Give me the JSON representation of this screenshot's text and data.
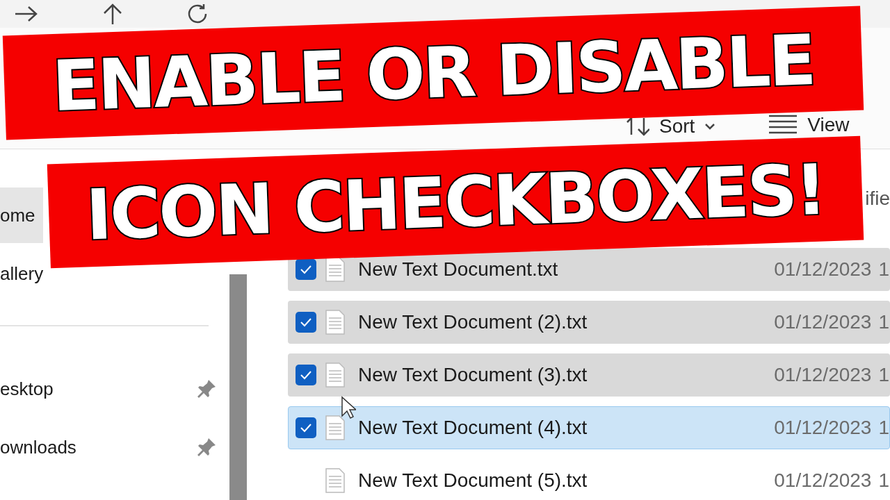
{
  "banner": {
    "lines": [
      "ENABLE OR DISABLE",
      "ICON CHECKBOXES!"
    ]
  },
  "toolbar": {
    "sort": {
      "label": "Sort"
    },
    "view": {
      "label": "View"
    }
  },
  "sidebar": {
    "items": [
      {
        "label": "ome",
        "selected": true,
        "pinned": false,
        "separator_before": false
      },
      {
        "label": "allery",
        "selected": false,
        "pinned": false,
        "separator_before": false
      },
      {
        "label": "esktop",
        "selected": false,
        "pinned": true,
        "separator_before": true
      },
      {
        "label": "ownloads",
        "selected": false,
        "pinned": true,
        "separator_before": false
      }
    ]
  },
  "file_list": {
    "columns": [
      {
        "label": "ifie"
      }
    ],
    "rows": [
      {
        "name": "New Text Document.txt",
        "date": "01/12/2023",
        "column_4": "1",
        "checked": true,
        "selected": true,
        "hovered": false
      },
      {
        "name": "New Text Document (2).txt",
        "date": "01/12/2023",
        "column_4": "1",
        "checked": true,
        "selected": true,
        "hovered": false
      },
      {
        "name": "New Text Document (3).txt",
        "date": "01/12/2023",
        "column_4": "1",
        "checked": true,
        "selected": true,
        "hovered": false
      },
      {
        "name": "New Text Document (4).txt",
        "date": "01/12/2023",
        "column_4": "1",
        "checked": true,
        "selected": true,
        "hovered": true
      },
      {
        "name": "New Text Document (5).txt",
        "date": "01/12/2023",
        "column_4": "1",
        "checked": false,
        "selected": false,
        "hovered": false
      }
    ]
  }
}
